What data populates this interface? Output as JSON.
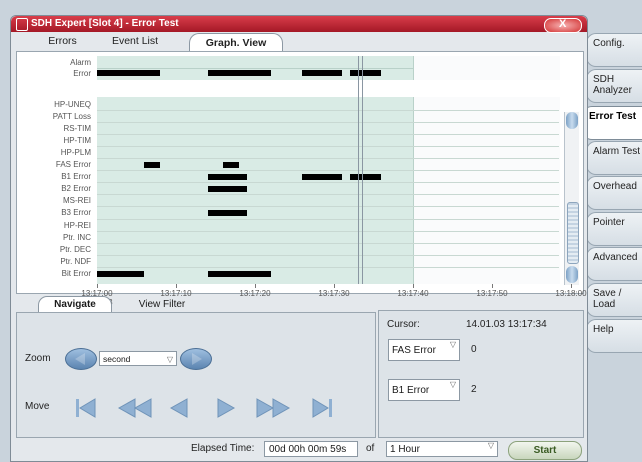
{
  "window": {
    "title": "SDH Expert [Slot 4]  -  Error Test",
    "close_label": "X"
  },
  "tabs": [
    "Errors",
    "Event List",
    "Graph. View"
  ],
  "right_tabs": [
    "Config.",
    "SDH Analyzer",
    "Error Test",
    "Alarm Test",
    "Overhead",
    "Pointer",
    "Advanced",
    "Save / Load",
    "Help"
  ],
  "graph": {
    "summary_rows": [
      "Alarm",
      "Error"
    ],
    "detail_rows": [
      "HP-UNEQ",
      "PATT Loss",
      "RS-TIM",
      "HP-TIM",
      "HP-PLM",
      "FAS Error",
      "B1 Error",
      "B2 Error",
      "MS-REI",
      "B3 Error",
      "HP-REI",
      "Ptr. INC",
      "Ptr. DEC",
      "Ptr. NDF",
      "Bit Error"
    ],
    "time_ticks": [
      "13:17:00",
      "13:17:10",
      "13:17:20",
      "13:17:30",
      "13:17:40",
      "13:17:50",
      "13:18:00"
    ],
    "date_label": "14.01.03",
    "cursor_time": "13:17:34",
    "events": {
      "Error": [
        [
          "13:17:00",
          "13:17:08"
        ],
        [
          "13:17:14",
          "13:17:22"
        ],
        [
          "13:17:26",
          "13:17:31"
        ],
        [
          "13:17:32",
          "13:17:36"
        ]
      ],
      "FAS Error": [
        [
          "13:17:06",
          "13:17:08"
        ],
        [
          "13:17:16",
          "13:17:18"
        ]
      ],
      "B1 Error": [
        [
          "13:17:14",
          "13:17:19"
        ],
        [
          "13:17:26",
          "13:17:31"
        ],
        [
          "13:17:32",
          "13:17:36"
        ]
      ],
      "B2 Error": [
        [
          "13:17:14",
          "13:17:19"
        ]
      ],
      "B3 Error": [
        [
          "13:17:14",
          "13:17:19"
        ]
      ],
      "Bit Error": [
        [
          "13:17:00",
          "13:17:06"
        ],
        [
          "13:17:14",
          "13:17:22"
        ]
      ]
    },
    "colors": {
      "band": "#d9ebe5",
      "bar": "#000000"
    }
  },
  "nav_tabs": [
    "Navigate",
    "View Filter"
  ],
  "navigate": {
    "zoom_label": "Zoom",
    "zoom_value": "second",
    "move_label": "Move"
  },
  "cursor_panel": {
    "cursor_label": "Cursor:",
    "cursor_value": "14.01.03 13:17:34",
    "counters": [
      {
        "name": "FAS Error",
        "value": "0"
      },
      {
        "name": "B1 Error",
        "value": "2"
      }
    ]
  },
  "status": {
    "elapsed_label": "Elapsed Time:",
    "elapsed_value": "00d 00h 00m 59s",
    "of_label": "of",
    "duration_value": "1 Hour",
    "start_label": "Start"
  }
}
